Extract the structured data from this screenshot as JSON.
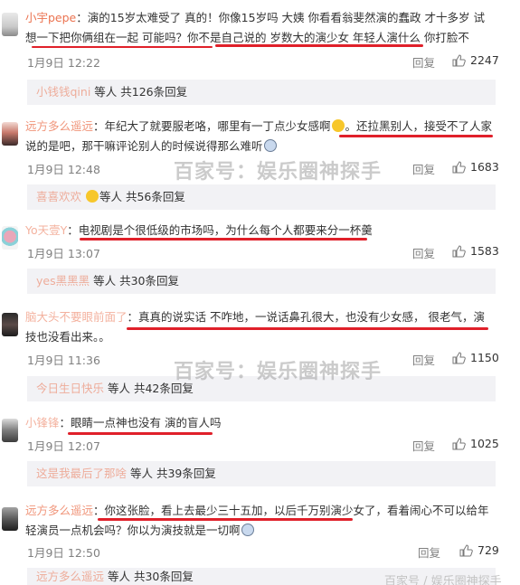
{
  "comments": [
    {
      "user": "小宇pepe",
      "text": "演的15岁太难受了 真的！你像15岁吗 大姨 你看看翁斐然演的蠢政 才十多岁 试想一下把你俩组在一起 可能吗？你不是自己说的 岁数大的演少女 年轻人演什么 你打脸不",
      "date": "1月9日 12:22",
      "reply_label": "回复",
      "likes": "2247",
      "sub_user": "小钱钱qini",
      "sub_text": "等人 共126条回复"
    },
    {
      "user": "远方多么遥远",
      "text_a": "年纪大了就要服老咯，哪里有一丁点少女感啊",
      "text_b": "。还拉黑别人，接受不了人家说的是吧，那干嘛评论别人的时候说得那么难听",
      "date": "1月9日 12:48",
      "reply_label": "回复",
      "likes": "1683",
      "sub_user": "喜喜欢欢",
      "sub_text": "等人 共56条回复"
    },
    {
      "user": "Yo天壹Y",
      "text": "电视剧是个很低级的市场吗，为什么每个人都要来分一杯羹",
      "date": "1月9日 13:07",
      "reply_label": "回复",
      "likes": "1583",
      "sub_user": "yes黑黑黑",
      "sub_text": "等人 共30条回复"
    },
    {
      "user": "脑大头不要眼前面了",
      "text": "真真的说实话  不咋地，一说话鼻孔很大，也没有少女感， 很老气，演技也没看出来。。",
      "date": "1月9日 11:36",
      "reply_label": "回复",
      "likes": "1150",
      "sub_user": "今日生日快乐",
      "sub_text": "等人 共42条回复"
    },
    {
      "user": "小锋锋",
      "text": "眼睛一点神也没有 演的盲人吗",
      "date": "1月9日 12:07",
      "reply_label": "回复",
      "likes": "1025",
      "sub_user": "这是我最后了那啥",
      "sub_text": "等人 共39条回复"
    },
    {
      "user": "远方多么遥远",
      "text": "你这张脸，看上去最少三十五加，以后千万别演少女了，看着闹心不可以给年轻演员一点机会吗？你以为演技就是一切啊",
      "date": "1月9日 12:50",
      "reply_label": "回复",
      "likes": "729",
      "sub_user": "远方多么遥远",
      "sub_text": "等人 共30条回复"
    }
  ],
  "watermarks": {
    "main": "百家号：娱乐圈神探手",
    "corner": "百家号 / 娱乐圈神探手"
  },
  "colors": {
    "username": "#eb7350",
    "underline": "#e0202a",
    "subbar": "#f2f2f5"
  }
}
